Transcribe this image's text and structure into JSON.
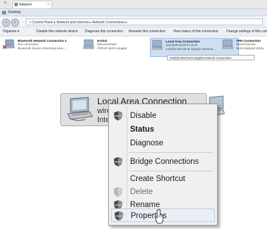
{
  "browser": {
    "tab_label": "Network Connections",
    "tab_close": "×",
    "title": "Desktop"
  },
  "address": {
    "back": "‹",
    "forward": "›",
    "path": "« Control Panel ▸ Network and Internet ▸ Network Connections ▸"
  },
  "commands": [
    "Organize ▾",
    "Disable this network device",
    "Diagnose this connection",
    "Rename this connection",
    "View status of this connection",
    "Change settings of this conn"
  ],
  "connections": [
    {
      "name": "Bluetooth Network Connection 2",
      "line1": "Not connected",
      "line2": "Bluetooth Device (Personal Area ...",
      "icon": "bluetooth-network-icon"
    },
    {
      "name": "Evrhol",
      "line1": "Disconnected",
      "line2": "PPPoP WAN Adapter",
      "icon": "network-icon"
    },
    {
      "name": "Local Area Connection",
      "line1": "wampathsystems.local",
      "line2": "Intel(R) 82579LM Gigabit Network...",
      "icon": "network-icon"
    },
    {
      "name": "VPN Connection",
      "line1": "Disconnected",
      "line2": "WAN Miniport (IKEv",
      "icon": "network-icon"
    }
  ],
  "tooltip": "Intel(R) 82579LM Gigabit Network Connection",
  "zoom": {
    "name": "Local Area Connection",
    "line2": "wire",
    "line3": "Intel"
  },
  "context_menu": [
    {
      "label": "Disable",
      "shield": true,
      "disabled": false,
      "bold": false
    },
    {
      "label": "Status",
      "shield": false,
      "disabled": false,
      "bold": true
    },
    {
      "label": "Diagnose",
      "shield": false,
      "disabled": false,
      "bold": false
    },
    {
      "label": "Bridge Connections",
      "shield": true,
      "disabled": false,
      "bold": false
    },
    {
      "label": "Create Shortcut",
      "shield": false,
      "disabled": false,
      "bold": false
    },
    {
      "label": "Delete",
      "shield": true,
      "disabled": true,
      "bold": false
    },
    {
      "label": "Rename",
      "shield": true,
      "disabled": false,
      "bold": false
    },
    {
      "label": "Properties",
      "shield": true,
      "disabled": false,
      "bold": false,
      "highlighted": true
    }
  ],
  "icons": {
    "shield": "uac-shield-icon",
    "cursor": "mouse-cursor-icon"
  },
  "colors": {
    "selection": "#cfdff2",
    "menu_bg": "#f0f0f0",
    "highlight": "#e8eef6"
  }
}
